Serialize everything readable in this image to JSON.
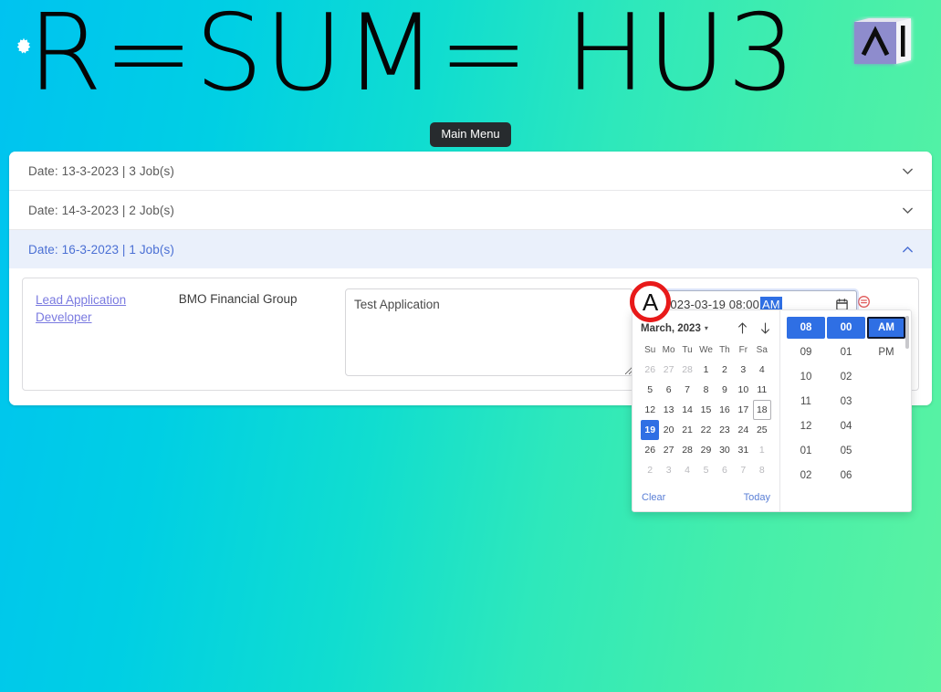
{
  "header": {
    "gear_icon": "gear-icon",
    "wordmark": "R=SUM= HU3",
    "logo_icon": "ai-cube-logo-icon"
  },
  "main_menu": {
    "label": "Main Menu"
  },
  "accordion": {
    "items": [
      {
        "label": "Date: 13-3-2023 | 3 Job(s)",
        "expanded": false,
        "chevron": "chevron-down-icon"
      },
      {
        "label": "Date: 14-3-2023 | 2 Job(s)",
        "expanded": false,
        "chevron": "chevron-down-icon"
      },
      {
        "label": "Date: 16-3-2023 | 1 Job(s)",
        "expanded": true,
        "chevron": "chevron-up-icon"
      }
    ]
  },
  "job_row": {
    "title": "Lead Application Developer",
    "company": "BMO Financial Group",
    "notes_value": "Test Application",
    "notes_placeholder": "",
    "delete_icon": "remove-circle-icon"
  },
  "datetime_input": {
    "value_date": "2023-03-19 08:00 ",
    "value_ampm": "AM",
    "calendar_icon": "calendar-icon"
  },
  "annotation": {
    "marker_label": "A"
  },
  "datetime_picker": {
    "month_label": "March, 2023",
    "month_caret": "▾",
    "nav_prev_icon": "arrow-up-icon",
    "nav_next_icon": "arrow-down-icon",
    "weekdays": [
      "Su",
      "Mo",
      "Tu",
      "We",
      "Th",
      "Fr",
      "Sa"
    ],
    "weeks": [
      [
        {
          "d": "26",
          "muted": true
        },
        {
          "d": "27",
          "muted": true
        },
        {
          "d": "28",
          "muted": true
        },
        {
          "d": "1"
        },
        {
          "d": "2"
        },
        {
          "d": "3"
        },
        {
          "d": "4"
        }
      ],
      [
        {
          "d": "5"
        },
        {
          "d": "6"
        },
        {
          "d": "7"
        },
        {
          "d": "8"
        },
        {
          "d": "9"
        },
        {
          "d": "10"
        },
        {
          "d": "11"
        }
      ],
      [
        {
          "d": "12"
        },
        {
          "d": "13"
        },
        {
          "d": "14"
        },
        {
          "d": "15"
        },
        {
          "d": "16"
        },
        {
          "d": "17"
        },
        {
          "d": "18",
          "today": true
        }
      ],
      [
        {
          "d": "19",
          "selected": true
        },
        {
          "d": "20"
        },
        {
          "d": "21"
        },
        {
          "d": "22"
        },
        {
          "d": "23"
        },
        {
          "d": "24"
        },
        {
          "d": "25"
        }
      ],
      [
        {
          "d": "26"
        },
        {
          "d": "27"
        },
        {
          "d": "28"
        },
        {
          "d": "29"
        },
        {
          "d": "30"
        },
        {
          "d": "31"
        },
        {
          "d": "1",
          "muted": true
        }
      ],
      [
        {
          "d": "2",
          "muted": true
        },
        {
          "d": "3",
          "muted": true
        },
        {
          "d": "4",
          "muted": true
        },
        {
          "d": "5",
          "muted": true
        },
        {
          "d": "6",
          "muted": true
        },
        {
          "d": "7",
          "muted": true
        },
        {
          "d": "8",
          "muted": true
        }
      ]
    ],
    "clear_label": "Clear",
    "today_label": "Today",
    "hours": [
      {
        "v": "08",
        "selected": true
      },
      {
        "v": "09"
      },
      {
        "v": "10"
      },
      {
        "v": "11"
      },
      {
        "v": "12"
      },
      {
        "v": "01"
      },
      {
        "v": "02"
      }
    ],
    "minutes": [
      {
        "v": "00",
        "selected": true
      },
      {
        "v": "01"
      },
      {
        "v": "02"
      },
      {
        "v": "03"
      },
      {
        "v": "04"
      },
      {
        "v": "05"
      },
      {
        "v": "06"
      }
    ],
    "meridiem": [
      {
        "v": "AM",
        "selected": true,
        "focused": true
      },
      {
        "v": "PM"
      }
    ]
  },
  "colors": {
    "accent_blue": "#2f6fe4",
    "annotation_red": "#e81a1a",
    "expanded_row_bg": "#eaf0fb",
    "link_purple": "#7a7ae0",
    "gradient_start": "#00c3f0",
    "gradient_end": "#5bf3a2",
    "menu_button_bg": "#272b2e"
  }
}
